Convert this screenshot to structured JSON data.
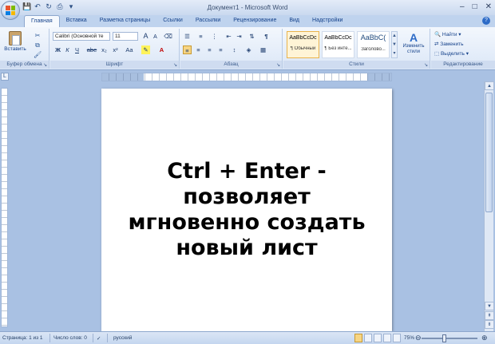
{
  "window": {
    "title": "Документ1 - Microsoft Word",
    "controls": {
      "minimize": "–",
      "maximize": "□",
      "close": "✕"
    }
  },
  "quick_access": [
    "save-icon",
    "undo-icon",
    "redo-icon",
    "print-preview-icon",
    "customize-icon"
  ],
  "tabs": [
    {
      "label": "Главная",
      "active": true
    },
    {
      "label": "Вставка",
      "active": false
    },
    {
      "label": "Разметка страницы",
      "active": false
    },
    {
      "label": "Ссылки",
      "active": false
    },
    {
      "label": "Рассылки",
      "active": false
    },
    {
      "label": "Рецензирование",
      "active": false
    },
    {
      "label": "Вид",
      "active": false
    },
    {
      "label": "Надстройки",
      "active": false
    }
  ],
  "ribbon": {
    "clipboard": {
      "paste_label": "Вставить",
      "group_label": "Буфер обмена"
    },
    "font": {
      "font_name": "Calibri (Основной те",
      "font_size": "11",
      "group_label": "Шрифт",
      "bold": "Ж",
      "italic": "К",
      "underline": "Ч",
      "strikethrough": "abe",
      "subscript": "x₂",
      "superscript": "x²",
      "change_case": "Aa",
      "grow": "A",
      "shrink": "A"
    },
    "paragraph": {
      "group_label": "Абзац",
      "pilcrow": "¶"
    },
    "styles": {
      "group_label": "Стили",
      "items": [
        {
          "sample": "AaBbCcDc",
          "name": "¶ Обычный",
          "selected": true
        },
        {
          "sample": "AaBbCcDc",
          "name": "¶ Без инте...",
          "selected": false
        },
        {
          "sample": "AaBbC(",
          "name": "Заголово...",
          "selected": false
        }
      ],
      "change_styles_label_1": "Изменить",
      "change_styles_label_2": "стили"
    },
    "editing": {
      "group_label": "Редактирование",
      "find": "Найти",
      "replace": "Заменить",
      "select": "Выделить"
    }
  },
  "document": {
    "lines": [
      "Ctrl + Enter -",
      "позволяет",
      "мгновенно создать",
      "новый лист"
    ]
  },
  "statusbar": {
    "page": "Страница: 1 из 1",
    "words": "Число слов: 0",
    "language": "русский",
    "zoom": "75%"
  }
}
